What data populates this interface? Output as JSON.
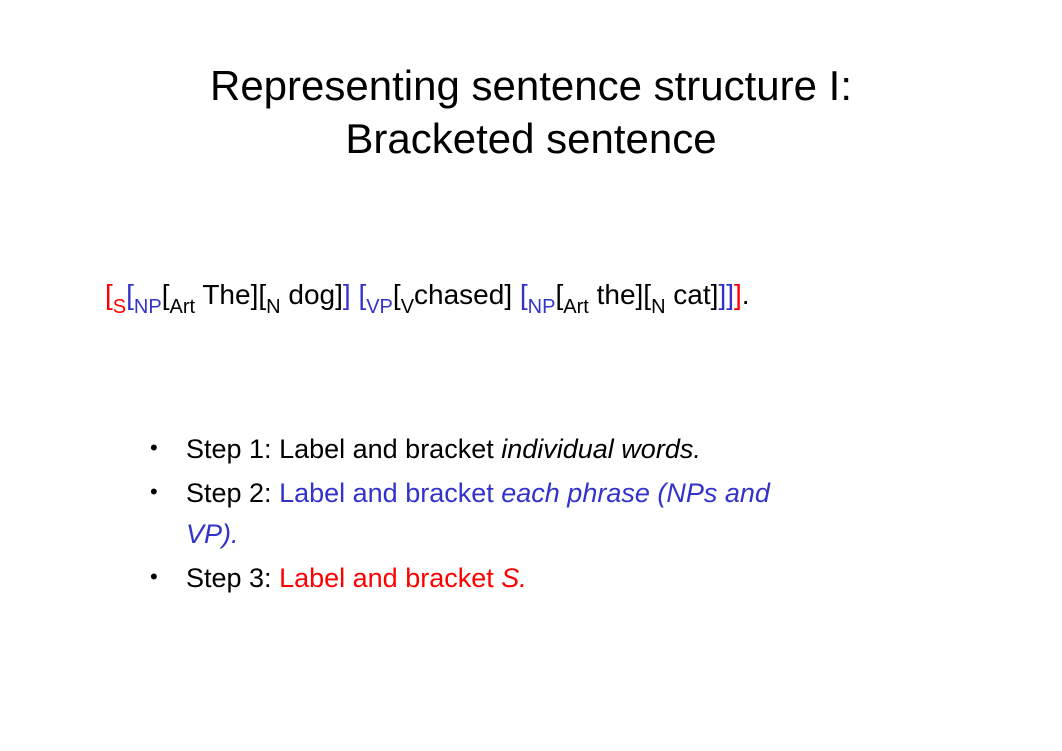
{
  "title_line1": "Representing sentence structure I:",
  "title_line2": "Bracketed sentence",
  "bracketed": {
    "lb": "[",
    "rb": "]",
    "S": "S",
    "NP": "NP",
    "Art": "Art",
    "N": "N",
    "VP": "VP",
    "V": "V",
    "The": " The",
    "dog": " dog",
    "chased": "chased",
    "the": " the",
    "cat": " cat",
    "dot": "."
  },
  "steps": {
    "s1_prefix": "Step 1: Label and bracket ",
    "s1_ital": "individual words.",
    "s2_prefix": "Step 2: ",
    "s2_blue_plain": "Label and bracket ",
    "s2_blue_ital_a": "each phrase (NPs and",
    "s2_blue_ital_b": "VP).",
    "s3_prefix": "Step 3: ",
    "s3_red_plain": "Label and bracket ",
    "s3_red_ital": "S.",
    "sp": " "
  }
}
